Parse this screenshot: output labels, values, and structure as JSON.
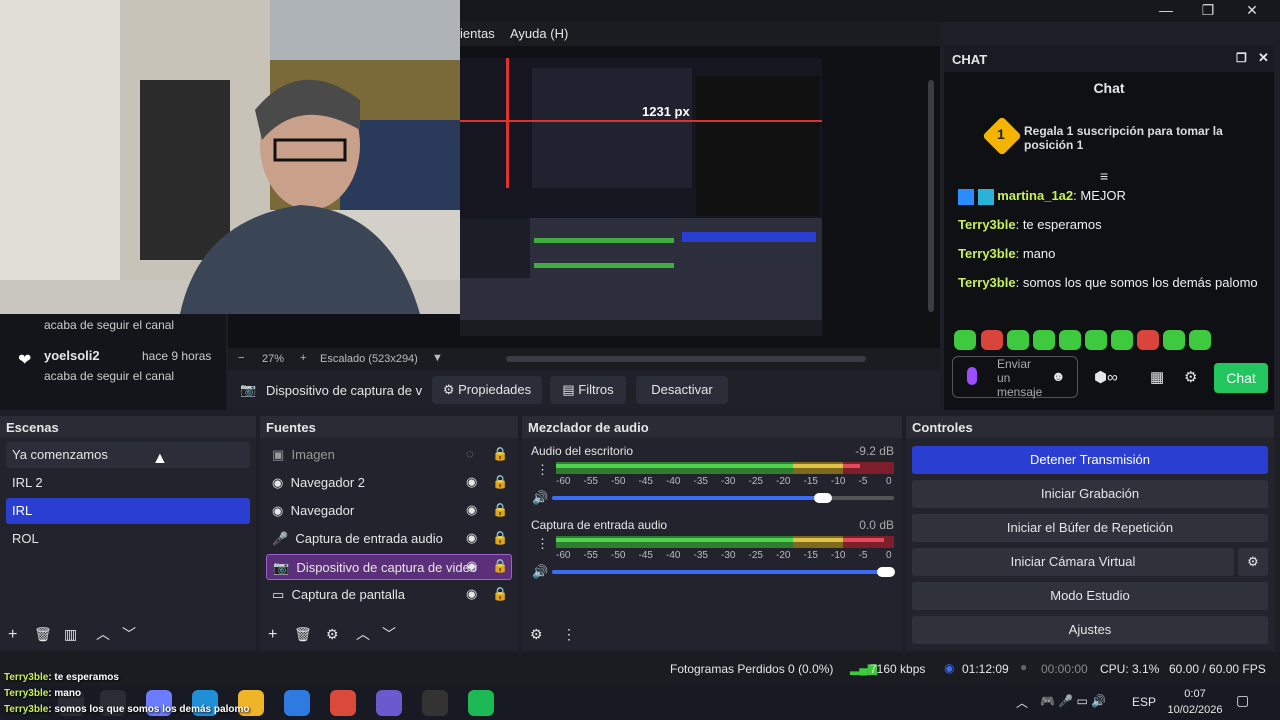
{
  "menu": {
    "partial_item": "ientas",
    "help": "Ayuda (H)"
  },
  "preview": {
    "px_label": "1231 px",
    "zoom": "27%",
    "scale": "Escalado (523x294)"
  },
  "feed": [
    {
      "name": "",
      "sub": "acaba de seguir el canal"
    },
    {
      "name": "yoelsoli2",
      "time": "hace 9 horas",
      "sub": "acaba de seguir el canal"
    }
  ],
  "source_toolbar": {
    "device": "Dispositivo de captura de v",
    "properties": "Propiedades",
    "filters": "Filtros",
    "deactivate": "Desactivar"
  },
  "chat": {
    "dock_title": "CHAT",
    "title": "Chat",
    "gift": "Regala 1 suscripción para tomar la posición 1",
    "messages": [
      {
        "user": "martina_1a2",
        "text": "MEJOR"
      },
      {
        "user": "Terry3ble",
        "text": "te esperamos"
      },
      {
        "user": "Terry3ble",
        "text": "mano"
      },
      {
        "user": "Terry3ble",
        "text": "somos los que somos los demás palomo"
      }
    ],
    "input_placeholder": "Enviar un mensaje",
    "send": "Chat"
  },
  "scenes": {
    "title": "Escenas",
    "items": [
      "Ya comenzamos",
      "IRL 2",
      "IRL",
      "ROL"
    ],
    "selected": "IRL"
  },
  "sources": {
    "title": "Fuentes",
    "items": [
      "Imagen",
      "Navegador 2",
      "Navegador",
      "Captura de entrada audio",
      "Dispositivo de captura de video",
      "Captura de pantalla"
    ]
  },
  "mixer": {
    "title": "Mezclador de audio",
    "tracks": [
      {
        "name": "Audio del escritorio",
        "db": "-9.2 dB",
        "level": 0.9,
        "volume": 0.8
      },
      {
        "name": "Captura de entrada audio",
        "db": "0.0 dB",
        "level": 0.97,
        "volume": 0.985
      }
    ],
    "ticks": [
      "-60",
      "-55",
      "-50",
      "-45",
      "-40",
      "-35",
      "-30",
      "-25",
      "-20",
      "-15",
      "-10",
      "-5",
      "0"
    ]
  },
  "controls": {
    "title": "Controles",
    "buttons": [
      "Detener Transmisión",
      "Iniciar Grabación",
      "Iniciar el Búfer de Repetición",
      "Iniciar Cámara Virtual",
      "Modo Estudio",
      "Ajustes"
    ]
  },
  "status": {
    "frames": "Fotogramas Perdidos 0 (0.0%)",
    "kbps": "7160 kbps",
    "stream_time": "01:12:09",
    "rec_time": "00:00:00",
    "cpu": "CPU: 3.1%",
    "fps": "60.00 / 60.00 FPS"
  },
  "overlay_chat": [
    {
      "user": "Terry3ble",
      "text": ": te esperamos"
    },
    {
      "user": "Terry3ble",
      "text": ": mano"
    },
    {
      "user": "Terry3ble",
      "text": ": somos los que somos los demás palomo"
    }
  ],
  "taskbar": {
    "lang": "ESP",
    "time": "0:07",
    "date": "10/02/2026"
  },
  "colors": {
    "accent": "#2a3fd1",
    "chat_user": "#c7f05a",
    "send_green": "#22c55e",
    "scene_selected": "#2a3fd1",
    "source_selected": "#5b2f7a"
  }
}
